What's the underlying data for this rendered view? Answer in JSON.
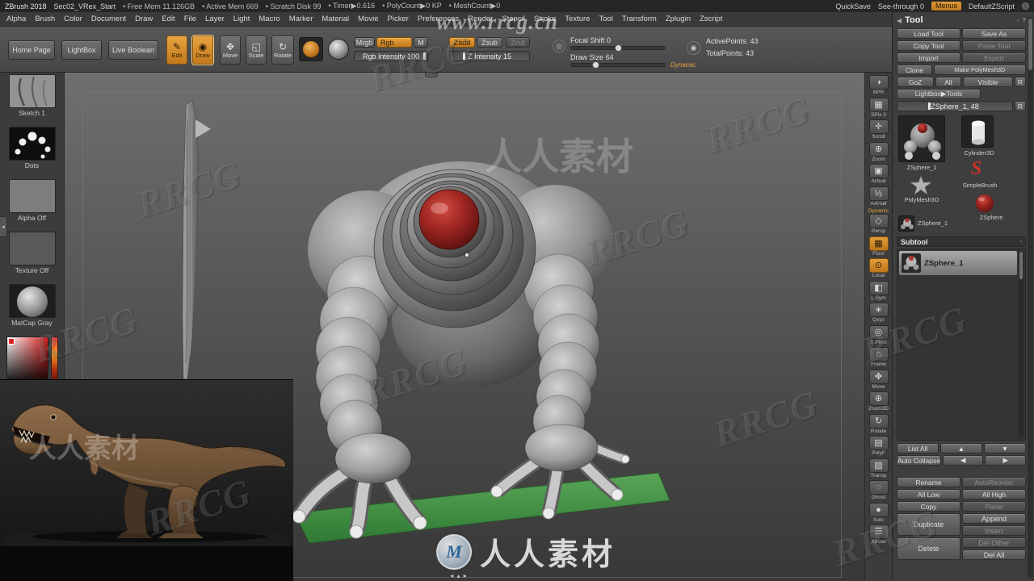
{
  "titlebar": {
    "app": "ZBrush 2018",
    "doc": "Sec02_VRex_Start",
    "stats": [
      "• Free Mem 11.126GB",
      "• Active Mem 669",
      "• Scratch Disk 99",
      "• Timer▶0.616",
      "• PolyCount▶0 KP",
      "• MeshCount▶0"
    ],
    "quicksave": "QuickSave",
    "see_through": "See-through 0",
    "menus": "Menus",
    "zscript": "DefaultZScript"
  },
  "menubar": {
    "items": [
      "Alpha",
      "Brush",
      "Color",
      "Document",
      "Draw",
      "Edit",
      "File",
      "Layer",
      "Light",
      "Macro",
      "Marker",
      "Material",
      "Movie",
      "Picker",
      "Preferences",
      "Render",
      "Stencil",
      "Stroke",
      "Texture",
      "Tool",
      "Transform",
      "Zplugin",
      "Zscript"
    ]
  },
  "shelf": {
    "home_page": "Home Page",
    "lightbox": "LightBox",
    "live_boolean": "Live Boolean",
    "modes": [
      {
        "glyph": "✎",
        "label": "Edit"
      },
      {
        "glyph": "◉",
        "label": "Draw"
      },
      {
        "glyph": "✥",
        "label": "Move"
      },
      {
        "glyph": "◱",
        "label": "Scale"
      },
      {
        "glyph": "↻",
        "label": "Rotate"
      }
    ],
    "mrgb": "Mrgb",
    "rgb": "Rgb",
    "m": "M",
    "rgb_intensity": "Rgb Intensity 100",
    "zadd": "Zadd",
    "zsub": "Zsub",
    "zcut": "Zcut",
    "z_intensity": "Z Intensity 15",
    "focal_shift": "Focal Shift 0",
    "draw_size": "Draw Size 64",
    "dynamic": "Dynamic",
    "active_points": "ActivePoints: 43",
    "total_points": "TotalPoints: 43"
  },
  "left_shelf": {
    "labels": [
      "Sketch 1",
      "Dots",
      "Alpha Off",
      "Texture Off",
      "MatCap Gray"
    ]
  },
  "right_strip": {
    "items": [
      {
        "glyph": "◑",
        "label": "BPR"
      },
      {
        "glyph": "▦",
        "label": "SPix 3"
      },
      {
        "glyph": "✛",
        "label": "Scroll"
      },
      {
        "glyph": "⊕",
        "label": "Zoom"
      },
      {
        "glyph": "▣",
        "label": "Actual"
      },
      {
        "glyph": "½",
        "label": "AAHalf"
      },
      {
        "glyph": "◇",
        "label": "Persp",
        "sub": "Dynamic"
      },
      {
        "glyph": "▦",
        "label": "Floor"
      },
      {
        "glyph": "⊙",
        "label": "Local"
      },
      {
        "glyph": "◧",
        "label": "L.Sym"
      },
      {
        "glyph": "∗",
        "label": "Qxyz"
      },
      {
        "glyph": "◎",
        "label": "S.Pivot"
      },
      {
        "glyph": "⌂",
        "label": "Frame"
      },
      {
        "glyph": "✥",
        "label": "Move"
      },
      {
        "glyph": "⊕",
        "label": "Zoom3D"
      },
      {
        "glyph": "↻",
        "label": "Rotate"
      },
      {
        "glyph": "▤",
        "label": "PolyF"
      },
      {
        "glyph": "▨",
        "label": "Transp"
      },
      {
        "glyph": "◌",
        "label": "Ghost"
      },
      {
        "glyph": "●",
        "label": "Solo"
      },
      {
        "glyph": "☰",
        "label": "Xpose"
      }
    ]
  },
  "tool_panel": {
    "title": "Tool",
    "load_tool": "Load Tool",
    "save_as": "Save As",
    "copy_tool": "Copy Tool",
    "paste_tool": "Paste Tool",
    "import": "Import",
    "export": "Export",
    "clone": "Clone",
    "make_polymesh": "Make PolyMesh3D",
    "goz": "GoZ",
    "all": "All",
    "visible": "Visible",
    "r": "R",
    "lightbox_tools": "Lightbox▶Tools",
    "active_slider": "ZSphere_1,  48",
    "thumbs": {
      "active_label": "ZSphere_1",
      "cylinder": "Cylinder3D",
      "simplebrush": "SimpleBrush",
      "polymesh": "PolyMesh3D",
      "zsphere": "ZSphere",
      "small_label": "ZSphere_1"
    },
    "subtool": {
      "header": "Subtool",
      "item": "ZSphere_1",
      "list_all": "List All",
      "auto_collapse": "Auto Collapse",
      "rename": "Rename",
      "autoreorder": "AutoReorder",
      "all_low": "All Low",
      "all_high": "All High",
      "copy": "Copy",
      "paste": "Paste",
      "duplicate": "Duplicate",
      "append": "Append",
      "insert": "Insert",
      "delete": "Delete",
      "del_other": "Del Other",
      "del_all": "Del All"
    }
  },
  "watermark": {
    "url": "www.rrcg.cn",
    "brand": "RRCG",
    "cn": "人人素材"
  },
  "icons": {
    "up": "▲",
    "down": "▼",
    "left": "◀",
    "right": "▶",
    "nub": "◂ ▴ ▸",
    "panel_dot": "◦",
    "panel_help": "?",
    "tray": "◂"
  }
}
